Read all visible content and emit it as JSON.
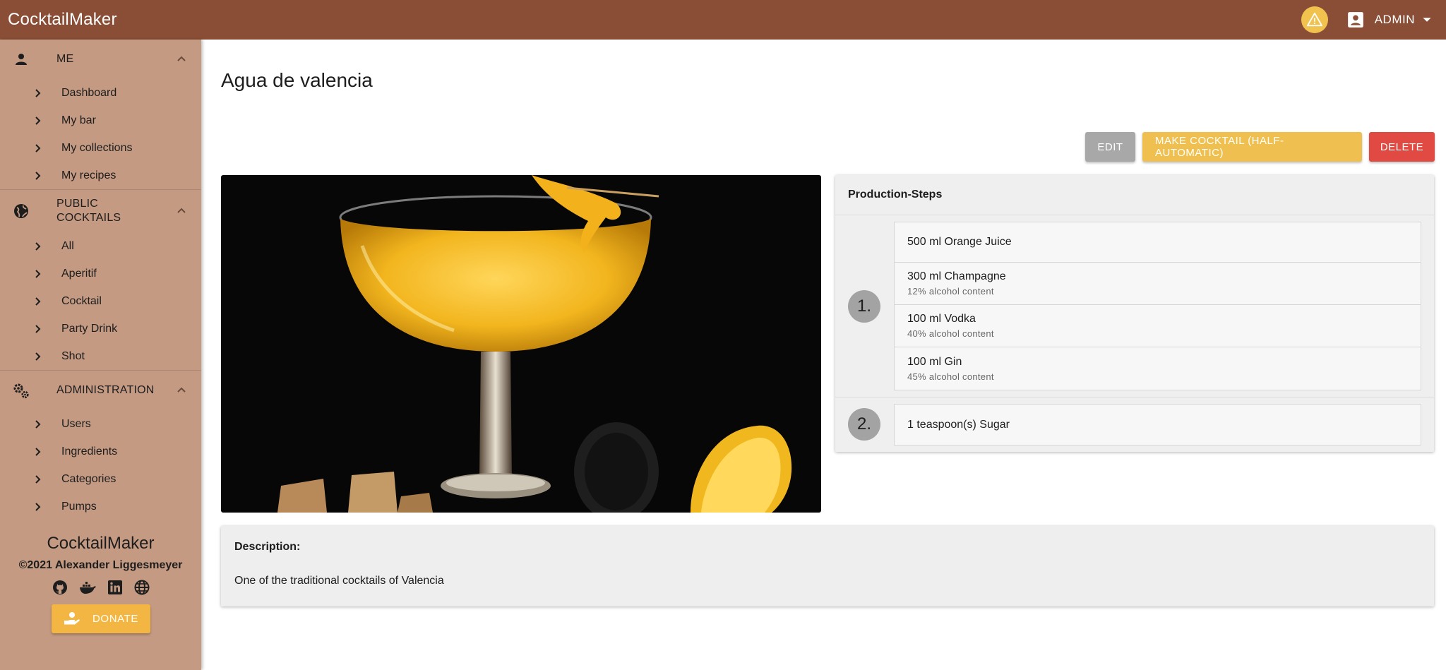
{
  "app": {
    "title": "CocktailMaker"
  },
  "header": {
    "user_label": "ADMIN"
  },
  "sidebar": {
    "groups": [
      {
        "label": "ME",
        "icon": "person-icon",
        "items": [
          {
            "label": "Dashboard"
          },
          {
            "label": "My bar"
          },
          {
            "label": "My collections"
          },
          {
            "label": "My recipes"
          }
        ]
      },
      {
        "label": "PUBLIC COCKTAILS",
        "icon": "globe-icon",
        "items": [
          {
            "label": "All"
          },
          {
            "label": "Aperitif"
          },
          {
            "label": "Cocktail"
          },
          {
            "label": "Party Drink"
          },
          {
            "label": "Shot"
          }
        ]
      },
      {
        "label": "ADMINISTRATION",
        "icon": "gears-icon",
        "items": [
          {
            "label": "Users"
          },
          {
            "label": "Ingredients"
          },
          {
            "label": "Categories"
          },
          {
            "label": "Pumps"
          }
        ]
      }
    ],
    "footer": {
      "brand": "CocktailMaker",
      "copyright": "©2021 Alexander Liggesmeyer",
      "icons": [
        "github-icon",
        "docker-icon",
        "linkedin-icon",
        "web-icon"
      ],
      "donate_label": "DONATE"
    }
  },
  "recipe": {
    "title": "Agua de valencia",
    "actions": {
      "edit": "EDIT",
      "make": "MAKE COCKTAIL (HALF-AUTOMATIC)",
      "delete": "DELETE"
    },
    "steps_title": "Production-Steps",
    "steps": [
      {
        "number": "1.",
        "ingredients": [
          {
            "name": "500 ml Orange Juice",
            "sub": ""
          },
          {
            "name": "300 ml Champagne",
            "sub": "12% alcohol content"
          },
          {
            "name": "100 ml Vodka",
            "sub": "40% alcohol content"
          },
          {
            "name": "100 ml Gin",
            "sub": "45% alcohol content"
          }
        ]
      },
      {
        "number": "2.",
        "ingredients": [
          {
            "name": "1 teaspoon(s) Sugar",
            "sub": ""
          }
        ]
      }
    ],
    "description_title": "Description:",
    "description": "One of the traditional cocktails of Valencia"
  },
  "colors": {
    "topbar": "#8a4e36",
    "sidebar": "#c49a83",
    "accent": "#f1c24d",
    "edit": "#a8a8a8",
    "make": "#efc04f",
    "delete": "#e04a43",
    "donate": "#f4b642"
  }
}
